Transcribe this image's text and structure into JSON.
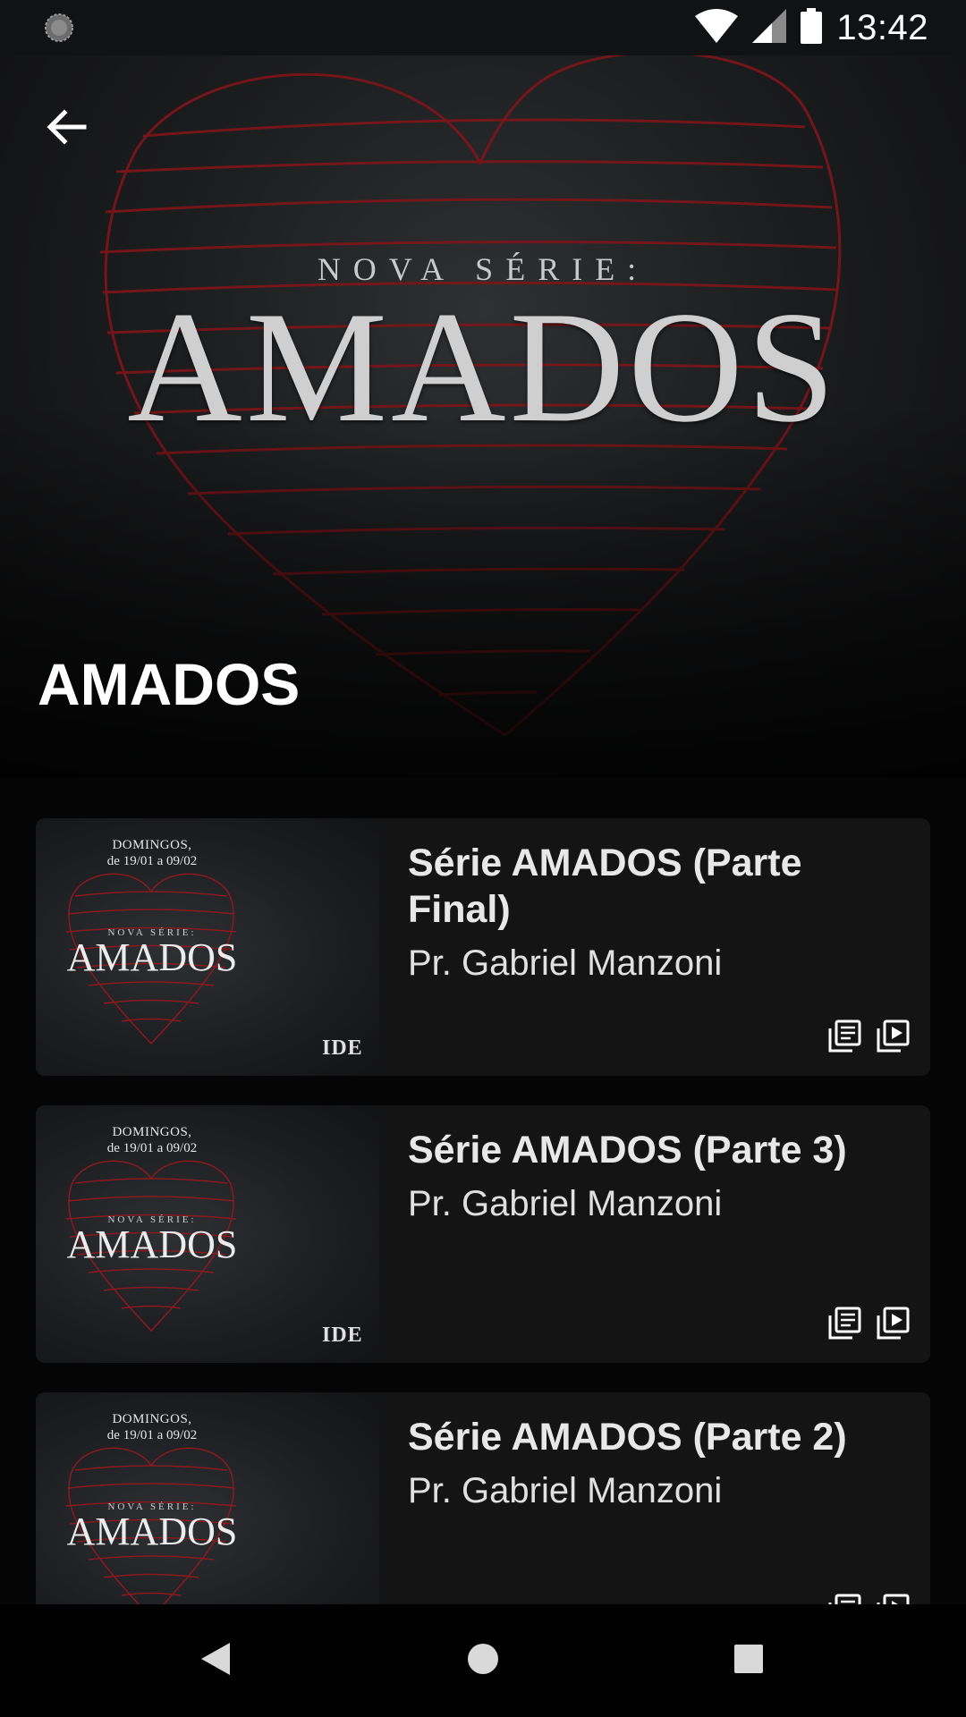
{
  "status_bar": {
    "time": "13:42",
    "left_icon": "sync-spinner-icon",
    "icons": [
      "wifi-icon",
      "cell-signal-icon",
      "battery-icon"
    ]
  },
  "hero": {
    "kicker": "NOVA SÉRIE:",
    "art_title": "AMADOS",
    "back_icon": "arrow-left-icon",
    "accent_color": "#8e1a1f"
  },
  "page": {
    "title": "AMADOS"
  },
  "items": [
    {
      "title": "Série AMADOS (Parte Final)",
      "author": "Pr. Gabriel Manzoni",
      "thumb_date_line1": "DOMINGOS,",
      "thumb_date_line2": "de 19/01 a 09/02",
      "thumb_kicker": "NOVA SÉRIE:",
      "thumb_title": "AMADOS",
      "thumb_logo": "IDE"
    },
    {
      "title": "Série AMADOS (Parte 3)",
      "author": "Pr. Gabriel Manzoni",
      "thumb_date_line1": "DOMINGOS,",
      "thumb_date_line2": "de 19/01 a 09/02",
      "thumb_kicker": "NOVA SÉRIE:",
      "thumb_title": "AMADOS",
      "thumb_logo": "IDE"
    },
    {
      "title": "Série AMADOS (Parte 2)",
      "author": "Pr. Gabriel Manzoni",
      "thumb_date_line1": "DOMINGOS,",
      "thumb_date_line2": "de 19/01 a 09/02",
      "thumb_kicker": "NOVA SÉRIE:",
      "thumb_title": "AMADOS",
      "thumb_logo": ""
    }
  ],
  "card_action_icons": [
    "notes-icon",
    "video-play-icon"
  ],
  "nav_bar": {
    "icons": [
      "nav-back-icon",
      "nav-home-icon",
      "nav-recents-icon"
    ]
  }
}
